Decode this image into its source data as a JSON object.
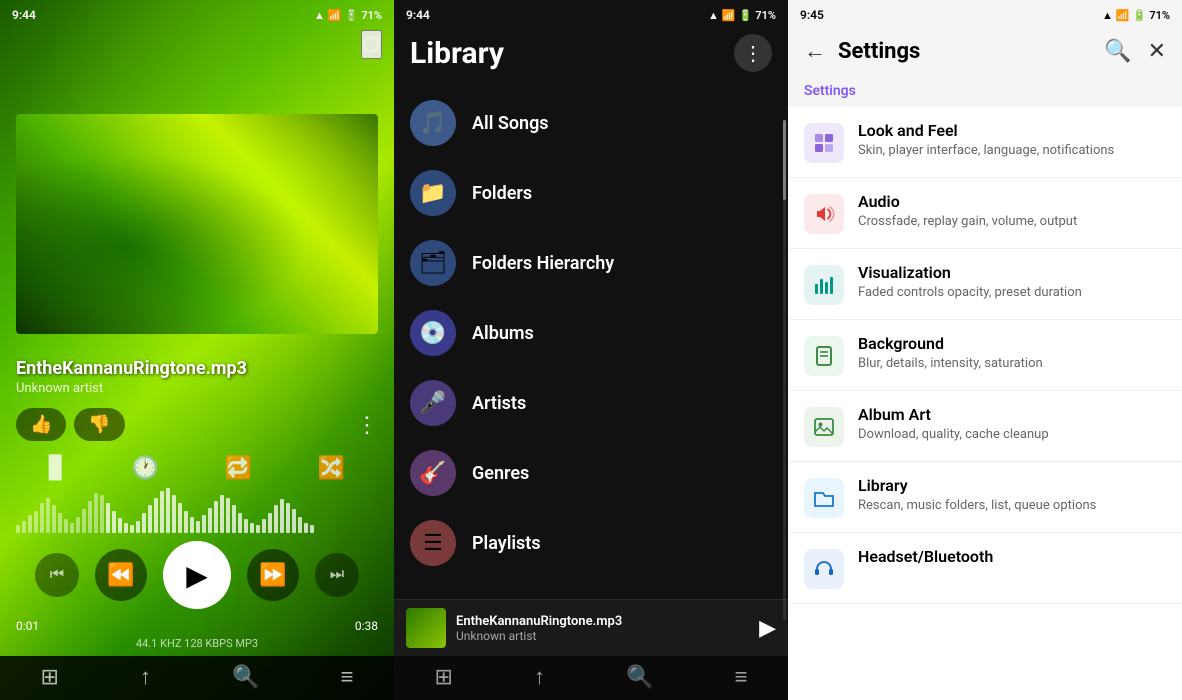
{
  "player": {
    "status_time": "9:44",
    "battery": "71%",
    "song_title": "EntheKannanuRingtone.mp3",
    "artist": "Unknown artist",
    "like_label": "👍",
    "dislike_label": "👎",
    "time_current": "0:01",
    "time_total": "0:38",
    "meta": "44.1 KHZ  128 KBPS  MP3",
    "nav_items": [
      "⊞",
      "↑",
      "🔍",
      "≡"
    ],
    "waveform_heights": [
      8,
      12,
      18,
      22,
      30,
      35,
      28,
      20,
      14,
      10,
      16,
      24,
      32,
      40,
      38,
      30,
      22,
      15,
      10,
      8,
      12,
      20,
      28,
      35,
      42,
      45,
      38,
      30,
      22,
      16,
      12,
      18,
      25,
      32,
      38,
      35,
      28,
      20,
      14,
      10,
      8,
      14,
      20,
      28,
      34,
      30,
      24,
      16,
      10,
      8
    ]
  },
  "library": {
    "status_time": "9:44",
    "battery": "71%",
    "title": "Library",
    "items": [
      {
        "label": "All Songs",
        "icon": "🎵",
        "bg": "#3d5a8a"
      },
      {
        "label": "Folders",
        "icon": "📁",
        "bg": "#2d4a7a"
      },
      {
        "label": "Folders Hierarchy",
        "icon": "🗂",
        "bg": "#2d4a7a"
      },
      {
        "label": "Albums",
        "icon": "💿",
        "bg": "#3a3a8a"
      },
      {
        "label": "Artists",
        "icon": "🎤",
        "bg": "#4a3a7a"
      },
      {
        "label": "Genres",
        "icon": "🎸",
        "bg": "#5a3a6a"
      },
      {
        "label": "Playlists",
        "icon": "☰",
        "bg": "#7a3a3a"
      }
    ],
    "mini_player": {
      "title": "EntheKannanuRingtone.mp3",
      "artist": "Unknown artist"
    },
    "nav_items": [
      "⊞",
      "↑",
      "🔍",
      "≡"
    ]
  },
  "settings": {
    "status_time": "9:45",
    "battery": "71%",
    "title": "Settings",
    "breadcrumb": "Settings",
    "back_label": "←",
    "search_icon": "🔍",
    "close_icon": "✕",
    "items": [
      {
        "title": "Look and Feel",
        "desc": "Skin, player interface, language, notifications",
        "icon": "▦",
        "icon_class": "icon-purple"
      },
      {
        "title": "Audio",
        "desc": "Crossfade, replay gain, volume, output",
        "icon": "🔊",
        "icon_class": "icon-red"
      },
      {
        "title": "Visualization",
        "desc": "Faded controls opacity, preset duration",
        "icon": "📊",
        "icon_class": "icon-teal"
      },
      {
        "title": "Background",
        "desc": "Blur, details, intensity, saturation",
        "icon": "🖼",
        "icon_class": "icon-green"
      },
      {
        "title": "Album Art",
        "desc": "Download, quality, cache cleanup",
        "icon": "🖼",
        "icon_class": "icon-green2"
      },
      {
        "title": "Library",
        "desc": "Rescan, music folders, list, queue options",
        "icon": "📁",
        "icon_class": "icon-blue"
      },
      {
        "title": "Headset/Bluetooth",
        "desc": "",
        "icon": "🎧",
        "icon_class": "icon-blue2"
      }
    ]
  }
}
